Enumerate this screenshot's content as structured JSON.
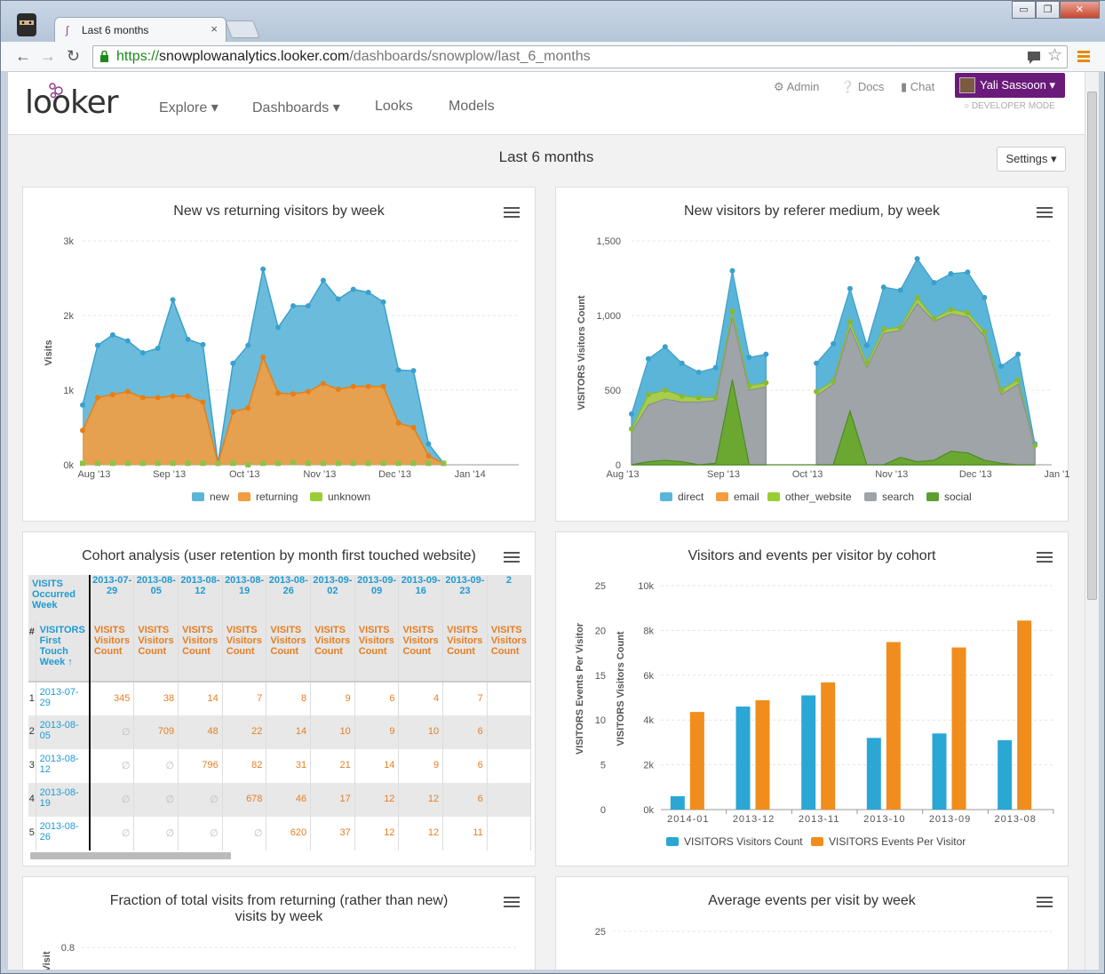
{
  "browser": {
    "tab_title": "Last 6 months",
    "url_scheme": "https://",
    "url_host": "snowplowanalytics.looker.com",
    "url_path": "/dashboards/snowplow/last_6_months",
    "window_controls": [
      "▭",
      "❐",
      "✕"
    ]
  },
  "app": {
    "logo": "looker",
    "nav": [
      "Explore ▾",
      "Dashboards ▾",
      "Looks",
      "Models"
    ],
    "top_links": {
      "admin": "Admin",
      "docs": "Docs",
      "chat": "Chat"
    },
    "user": "Yali Sassoon ▾",
    "dev_mode": "DEVELOPER MODE"
  },
  "dashboard": {
    "title": "Last 6 months",
    "settings": "Settings ▾"
  },
  "panels": {
    "p1": {
      "title": "New vs returning visitors by week"
    },
    "p2": {
      "title": "New visitors by referer medium, by week"
    },
    "p3": {
      "title": "Cohort analysis (user retention by month first touched website)"
    },
    "p4": {
      "title": "Visitors and events per visitor by cohort"
    },
    "p5": {
      "title": "Fraction of total visits from returning (rather than new) visits by week"
    },
    "p6": {
      "title": "Average events per visit by week"
    }
  },
  "cohort": {
    "corner": "VISITS Occurred Week",
    "hash": "#",
    "row_header": "VISITORS First Touch Week ↑",
    "col_dates": [
      "2013-07-29",
      "2013-08-05",
      "2013-08-12",
      "2013-08-19",
      "2013-08-26",
      "2013-09-02",
      "2013-09-09",
      "2013-09-16",
      "2013-09-23",
      "2"
    ],
    "measure": "VISITS Visitors Count",
    "rows": [
      {
        "n": "1",
        "week": "2013-07-29",
        "vals": [
          "345",
          "38",
          "14",
          "7",
          "8",
          "9",
          "6",
          "4",
          "7"
        ]
      },
      {
        "n": "2",
        "week": "2013-08-05",
        "vals": [
          "∅",
          "709",
          "48",
          "22",
          "14",
          "10",
          "9",
          "10",
          "6"
        ]
      },
      {
        "n": "3",
        "week": "2013-08-12",
        "vals": [
          "∅",
          "∅",
          "796",
          "82",
          "31",
          "21",
          "14",
          "9",
          "6"
        ]
      },
      {
        "n": "4",
        "week": "2013-08-19",
        "vals": [
          "∅",
          "∅",
          "∅",
          "678",
          "46",
          "17",
          "12",
          "12",
          "6"
        ]
      },
      {
        "n": "5",
        "week": "2013-08-26",
        "vals": [
          "∅",
          "∅",
          "∅",
          "∅",
          "620",
          "37",
          "12",
          "12",
          "11"
        ]
      }
    ]
  },
  "chart_data": [
    {
      "type": "area",
      "title": "New vs returning visitors by week",
      "ylabel": "Visits",
      "y_ticks": [
        "0k",
        "1k",
        "2k",
        "3k"
      ],
      "x_ticks": [
        "Aug '13",
        "Sep '13",
        "Oct '13",
        "Nov '13",
        "Dec '13",
        "Jan '14"
      ],
      "x_tick_index": [
        1,
        6,
        11,
        16,
        21,
        26
      ],
      "ylim": [
        0,
        3000
      ],
      "stacked": true,
      "series": [
        {
          "name": "unknown",
          "color": "#9acd32",
          "values": [
            20,
            20,
            20,
            20,
            20,
            20,
            20,
            20,
            20,
            20,
            20,
            0,
            20,
            20,
            30,
            20,
            20,
            20,
            20,
            20,
            20,
            20,
            20,
            20,
            20,
            20,
            20,
            20,
            20,
            20
          ]
        },
        {
          "name": "returning",
          "color": "#f39c40",
          "values": [
            440,
            880,
            920,
            960,
            880,
            880,
            900,
            900,
            820,
            0,
            690,
            760,
            1420,
            940,
            920,
            960,
            1070,
            990,
            1030,
            1030,
            1030,
            540,
            480,
            100,
            0,
            0,
            0,
            0,
            0,
            0
          ]
        },
        {
          "name": "new",
          "color": "#5bb5d8",
          "values": [
            340,
            700,
            800,
            680,
            600,
            660,
            1290,
            760,
            770,
            0,
            650,
            840,
            1180,
            880,
            1180,
            1150,
            1380,
            1210,
            1300,
            1260,
            1130,
            710,
            760,
            160,
            0,
            0,
            0,
            0,
            0,
            0
          ]
        }
      ]
    },
    {
      "type": "area",
      "title": "New visitors by referer medium, by week",
      "ylabel": "VISITORS Visitors Count",
      "y_ticks": [
        "0",
        "500",
        "1,000",
        "1,500"
      ],
      "x_ticks": [
        "Aug '13",
        "Sep '13",
        "Oct '13",
        "Nov '13",
        "Dec '13",
        "Jan '14"
      ],
      "ylim": [
        0,
        1500
      ],
      "series": [
        {
          "name": "direct",
          "color": "#5bb5d8"
        },
        {
          "name": "email",
          "color": "#f39c40"
        },
        {
          "name": "other_website",
          "color": "#9acd32"
        },
        {
          "name": "search",
          "color": "#9ea4a8"
        },
        {
          "name": "social",
          "color": "#5e9e2e"
        }
      ],
      "x": [
        0,
        1,
        2,
        3,
        4,
        5,
        6,
        7,
        8,
        9,
        10,
        11,
        12,
        13,
        14,
        15,
        16,
        17,
        18,
        19,
        20,
        21,
        22,
        23,
        24,
        25,
        26,
        27,
        28,
        29,
        30,
        31,
        32,
        33,
        34,
        35
      ],
      "totals": [
        340,
        710,
        790,
        680,
        620,
        650,
        1300,
        720,
        740,
        null,
        null,
        680,
        810,
        1180,
        800,
        1190,
        1170,
        1380,
        1220,
        1280,
        1290,
        1120,
        660,
        740,
        140,
        null,
        null,
        null,
        null,
        null,
        null,
        null,
        null,
        null,
        null,
        null
      ],
      "green": [
        240,
        470,
        500,
        460,
        450,
        450,
        1030,
        530,
        550,
        null,
        null,
        490,
        560,
        960,
        680,
        910,
        920,
        1120,
        980,
        1040,
        1020,
        890,
        500,
        570,
        130
      ],
      "grey": [
        220,
        400,
        440,
        420,
        420,
        430,
        990,
        500,
        520,
        null,
        null,
        460,
        540,
        920,
        650,
        880,
        900,
        1080,
        960,
        1010,
        990,
        860,
        470,
        540,
        120
      ],
      "social": [
        0,
        20,
        30,
        20,
        0,
        10,
        570,
        0,
        0,
        null,
        null,
        0,
        0,
        360,
        0,
        0,
        50,
        20,
        30,
        90,
        80,
        30,
        10,
        0,
        0
      ]
    },
    {
      "type": "bar",
      "title": "Visitors and events per visitor by cohort",
      "categories": [
        "2014-01",
        "2013-12",
        "2013-11",
        "2013-10",
        "2013-09",
        "2013-08"
      ],
      "y_left_label": "VISITORS Events Per Visitor",
      "y_left_ticks": [
        "0",
        "5",
        "10",
        "15",
        "20",
        "25"
      ],
      "y_right_label": "VISITORS Visitors Count",
      "y_right_ticks": [
        "0k",
        "2k",
        "4k",
        "6k",
        "8k",
        "10k"
      ],
      "series": [
        {
          "name": "VISITORS Visitors Count",
          "color": "#2aa7d5",
          "values": [
            600,
            4600,
            5100,
            3200,
            3400,
            3100
          ]
        },
        {
          "name": "VISITORS Events Per Visitor",
          "color": "#f08d1c",
          "values": [
            10.9,
            12.2,
            14.2,
            18.7,
            18.1,
            21.1
          ]
        }
      ]
    },
    {
      "type": "line",
      "title": "Fraction of total visits from returning (rather than new) visits by week",
      "ylabel": "Visit",
      "y_ticks": [
        "0.8"
      ]
    },
    {
      "type": "line",
      "title": "Average events per visit by week",
      "y_ticks": [
        "25"
      ]
    }
  ]
}
